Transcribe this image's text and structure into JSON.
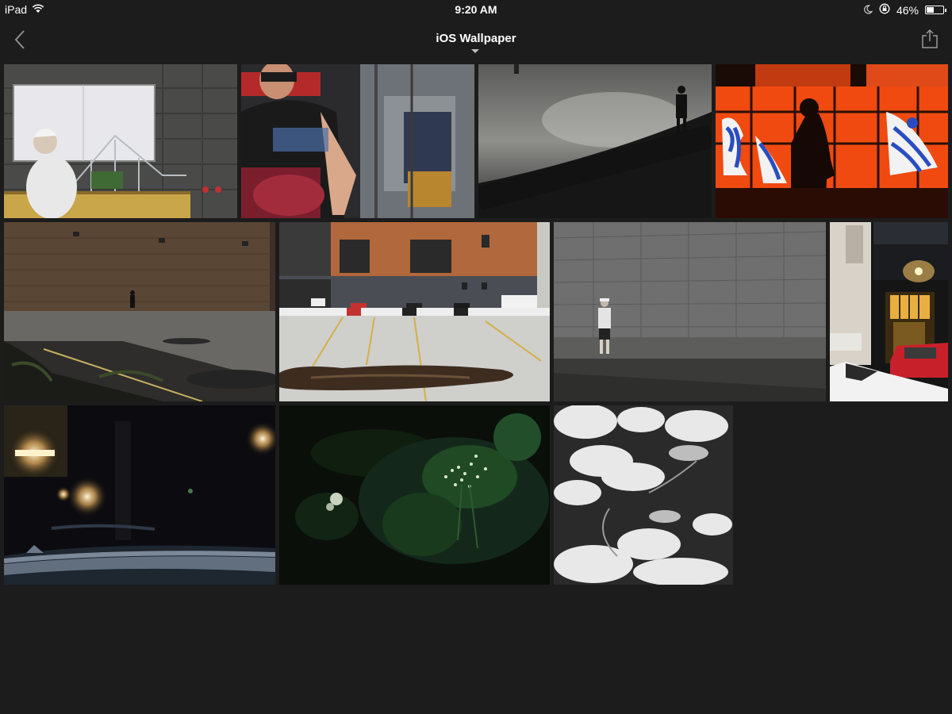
{
  "status_bar": {
    "device": "iPad",
    "time": "9:20 AM",
    "battery_percent": "46%",
    "battery_level": 0.46,
    "icons": [
      "wifi-icon",
      "moon-icon",
      "rotation-lock-icon",
      "battery-icon"
    ]
  },
  "nav": {
    "title": "iOS Wallpaper",
    "back_icon": "chevron-left-icon",
    "share_icon": "share-icon",
    "title_menu_icon": "caret-down-icon"
  },
  "colors": {
    "background": "#1c1c1c",
    "text": "#ffffff"
  },
  "photos": [
    {
      "id": "photo-1",
      "subject": "man-in-white-by-billboard"
    },
    {
      "id": "photo-2",
      "subject": "reflection-in-window"
    },
    {
      "id": "photo-3",
      "subject": "silhouette-on-wet-plaza"
    },
    {
      "id": "photo-4",
      "subject": "silhouette-red-window"
    },
    {
      "id": "photo-5",
      "subject": "brick-wall-parking-lot"
    },
    {
      "id": "photo-6",
      "subject": "parking-lot-puddle"
    },
    {
      "id": "photo-7",
      "subject": "man-walking-by-gray-wall"
    },
    {
      "id": "photo-8",
      "subject": "building-entrance-red-car"
    },
    {
      "id": "photo-9",
      "subject": "night-street-lights"
    },
    {
      "id": "photo-10",
      "subject": "dark-foliage-flowers"
    },
    {
      "id": "photo-11",
      "subject": "black-white-clouds"
    }
  ]
}
